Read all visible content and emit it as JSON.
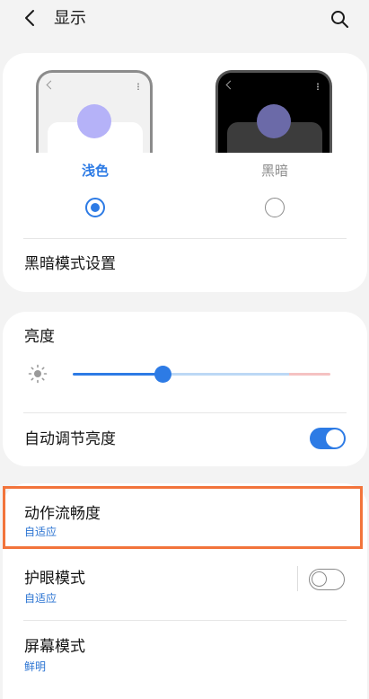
{
  "header": {
    "title": "显示",
    "back_icon": "chevron-left-icon",
    "search_icon": "search-icon"
  },
  "theme": {
    "light_label": "浅色",
    "dark_label": "黑暗",
    "selected": "light",
    "dark_settings_label": "黑暗模式设置"
  },
  "brightness": {
    "title": "亮度",
    "level": 0.35,
    "adaptive_label": "自动调节亮度",
    "adaptive_on": true
  },
  "motion": {
    "title": "动作流畅度",
    "value": "自适应"
  },
  "eye_comfort": {
    "title": "护眼模式",
    "value": "自适应",
    "on": false
  },
  "screen_mode": {
    "title": "屏幕模式",
    "value": "鲜明"
  },
  "colors": {
    "accent": "#2d7be5",
    "highlight": "#f2743b",
    "background": "#f3f3f3"
  }
}
